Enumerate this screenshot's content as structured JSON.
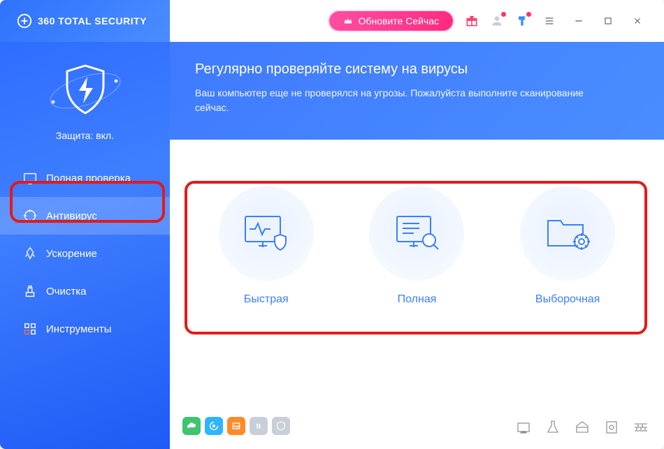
{
  "brand": {
    "name": "360 TOTAL SECURITY"
  },
  "titlebar": {
    "update_label": "Обновите Сейчас"
  },
  "sidebar": {
    "status_label": "Защита: вкл.",
    "items": [
      {
        "label": "Полная проверка",
        "icon": "monitor-icon",
        "active": false
      },
      {
        "label": "Антивирус",
        "icon": "crosshair-icon",
        "active": true
      },
      {
        "label": "Ускорение",
        "icon": "rocket-icon",
        "active": false
      },
      {
        "label": "Очистка",
        "icon": "broom-icon",
        "active": false
      },
      {
        "label": "Инструменты",
        "icon": "grid-icon",
        "active": false
      }
    ]
  },
  "hero": {
    "title": "Регулярно проверяйте систему на вирусы",
    "subtitle": "Ваш компьютер еще не проверялся на угрозы. Пожалуйста выполните сканирование сейчас."
  },
  "scans": [
    {
      "label": "Быстрая",
      "icon": "quick-scan-icon"
    },
    {
      "label": "Полная",
      "icon": "full-scan-icon"
    },
    {
      "label": "Выборочная",
      "icon": "custom-scan-icon"
    }
  ],
  "status_chips": [
    {
      "color": "#3fc46f",
      "icon": "cloud"
    },
    {
      "color": "#2fb4ff",
      "icon": "swirl"
    },
    {
      "color": "#ff8a2a",
      "icon": "image"
    },
    {
      "color": "#c9cfd8",
      "icon": "b"
    },
    {
      "color": "#c9cfd8",
      "icon": "check"
    }
  ]
}
